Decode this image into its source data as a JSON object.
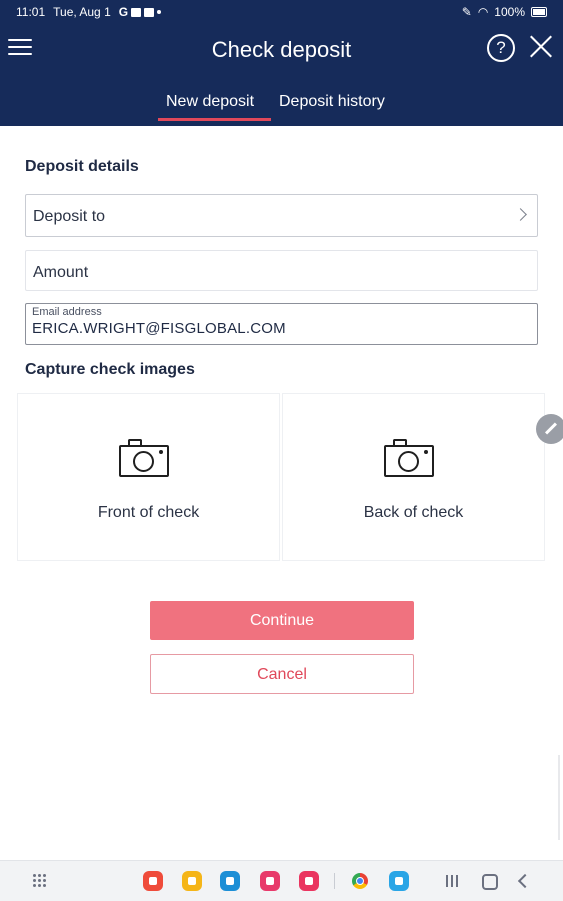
{
  "status_bar": {
    "time": "11:01",
    "date": "Tue, Aug 1",
    "notification_g": "G",
    "battery": "100%"
  },
  "header": {
    "title": "Check deposit",
    "help_symbol": "?",
    "tabs": [
      {
        "label": "New deposit",
        "active": true
      },
      {
        "label": "Deposit history",
        "active": false
      }
    ],
    "background_color": "#162b5a",
    "accent_color": "#e0485a"
  },
  "deposit_details": {
    "section_title": "Deposit details",
    "deposit_to_label": "Deposit to",
    "amount_placeholder": "Amount",
    "email_label": "Email address",
    "email_value": "ERICA.WRIGHT@FISGLOBAL.COM"
  },
  "capture": {
    "section_title": "Capture check images",
    "front_label": "Front of check",
    "back_label": "Back of check",
    "icon": "camera-icon"
  },
  "actions": {
    "continue_label": "Continue",
    "cancel_label": "Cancel",
    "continue_color": "#f0727f"
  },
  "bottom_nav": {
    "apps": [
      {
        "name": "office-app-icon",
        "color": "#ef4b3a"
      },
      {
        "name": "files-app-icon",
        "color": "#f5b518"
      },
      {
        "name": "calendar-app-icon",
        "color": "#1d8fd6"
      },
      {
        "name": "flower-app-icon",
        "color": "#e83a6b"
      },
      {
        "name": "video-app-icon",
        "color": "#ea3560"
      },
      {
        "name": "chrome-icon",
        "color": "#4285f4"
      },
      {
        "name": "messages-app-icon",
        "color": "#2aa5e6"
      }
    ]
  }
}
